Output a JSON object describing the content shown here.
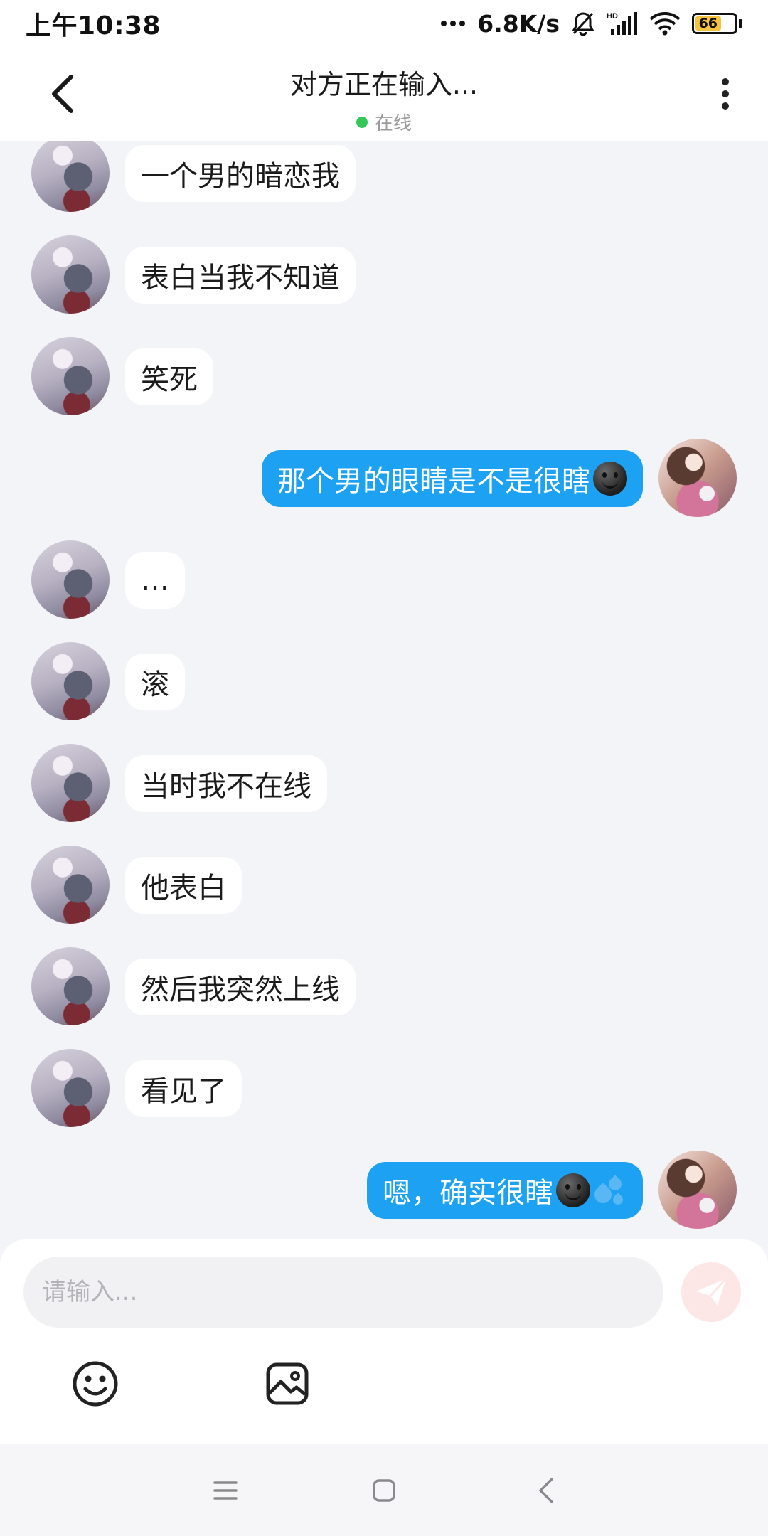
{
  "status_bar": {
    "time": "上午10:38",
    "network_speed": "6.8K/s",
    "battery": "66",
    "icons": [
      "more-dots-icon",
      "bell-muted-icon",
      "hd-signal-icon",
      "wifi-icon",
      "battery-icon"
    ]
  },
  "header": {
    "title": "对方正在输入...",
    "status_text": "在线",
    "status_color": "#34c759"
  },
  "messages": [
    {
      "side": "left",
      "text": "一个男的暗恋我"
    },
    {
      "side": "left",
      "text": "表白当我不知道"
    },
    {
      "side": "left",
      "text": "笑死"
    },
    {
      "side": "right",
      "text": "那个男的眼睛是不是很瞎",
      "emoji": "smirk-face"
    },
    {
      "side": "left",
      "text": "…"
    },
    {
      "side": "left",
      "text": "滚"
    },
    {
      "side": "left",
      "text": "当时我不在线"
    },
    {
      "side": "left",
      "text": "他表白"
    },
    {
      "side": "left",
      "text": "然后我突然上线"
    },
    {
      "side": "left",
      "text": "看见了"
    },
    {
      "side": "right",
      "text": "嗯，确实很瞎",
      "emoji": "smirk-face sweat-drops",
      "error": "!"
    }
  ],
  "input": {
    "placeholder": "请输入..."
  },
  "colors": {
    "self_bubble": "#1da1f2",
    "other_bubble": "#ffffff",
    "error": "#f04444",
    "background": "#f3f4f7"
  }
}
